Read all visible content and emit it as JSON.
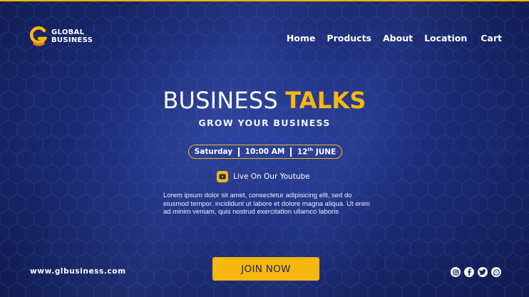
{
  "brand": {
    "line1": "GLOBAL",
    "line2": "BUSINESS",
    "logo_icon": "g-logo-icon",
    "accent_color": "#f6b711"
  },
  "nav": {
    "items": [
      "Home",
      "Products",
      "About",
      "Location",
      "Cart"
    ]
  },
  "hero": {
    "title_light": "BUSINESS",
    "title_accent": "TALKS",
    "subtitle": "GROW YOUR BUSINESS"
  },
  "event": {
    "day": "Saturday",
    "time": "10:00 AM",
    "date_num": "12",
    "date_suffix": "th",
    "date_month": "JUNE"
  },
  "live": {
    "icon": "youtube-icon",
    "label": "Live On Our Youtube"
  },
  "description": "Lorem ipsum dolor sit amet, consectetur adipisicing elit, sed do eiusmod tempor. incididunt ut labore et dolore magna aliqua. Ut enim ad minim veniam, quis nostrud exercitation ullamco laboris",
  "cta": {
    "label": "JOIN NOW"
  },
  "footer": {
    "website": "www.glbusiness.com",
    "social_icons": [
      "instagram-icon",
      "facebook-icon",
      "twitter-icon",
      "whatsapp-icon"
    ]
  },
  "colors": {
    "background": "#1c2c78",
    "accent": "#f6b711",
    "text": "#ffffff"
  }
}
